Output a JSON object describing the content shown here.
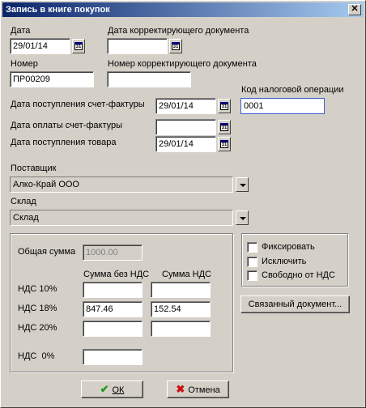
{
  "window": {
    "title": "Запись в книге покупок",
    "close_glyph": "✕"
  },
  "labels": {
    "date": "Дата",
    "corr_doc_date": "Дата корректирующего документа",
    "number": "Номер",
    "corr_doc_number": "Номер корректирующего документа",
    "tax_op_code": "Код налоговой операции",
    "invoice_received": "Дата поступления счет-фактуры",
    "invoice_paid": "Дата оплаты счет-фактуры",
    "goods_received": "Дата поступления товара",
    "supplier": "Поставщик",
    "warehouse": "Склад",
    "total": "Общая сумма",
    "sum_no_vat": "Сумма без НДС",
    "sum_vat": "Сумма НДС",
    "vat10": "НДС 10%",
    "vat18": "НДС 18%",
    "vat20": "НДС 20%",
    "vat0": "НДС  0%"
  },
  "values": {
    "date": "29/01/14",
    "corr_doc_date": "",
    "number": "ПР00209",
    "corr_doc_number": "",
    "tax_op_code": "0001",
    "invoice_received": "29/01/14",
    "invoice_paid": "",
    "goods_received": "29/01/14",
    "supplier": "Алко-Край ООО",
    "warehouse": "Склад",
    "total": "1000.00",
    "vat10_base": "",
    "vat10_vat": "",
    "vat18_base": "847.46",
    "vat18_vat": "152.54",
    "vat20_base": "",
    "vat20_vat": "",
    "vat0_base": ""
  },
  "calendar_icon_text": "31",
  "checkboxes": {
    "fix": "Фиксировать",
    "exclude": "Исключить",
    "vat_free": "Свободно от НДС"
  },
  "buttons": {
    "linked_doc": "Связанный документ...",
    "ok": "ОК",
    "cancel": "Отмена"
  }
}
